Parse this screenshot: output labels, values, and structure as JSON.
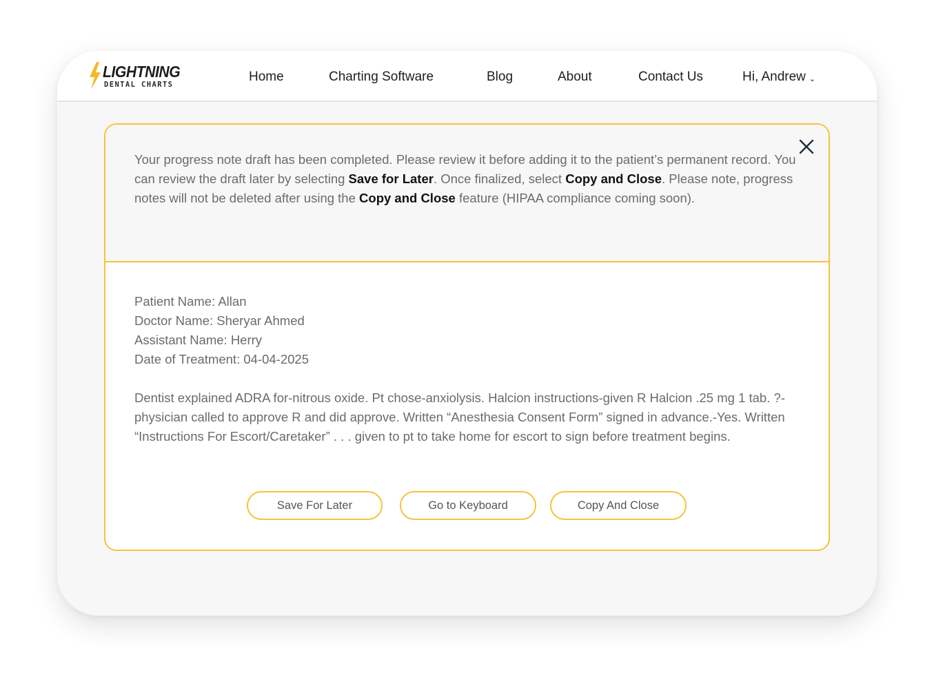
{
  "brand": {
    "name": "LIGHTNING",
    "tagline": "DENTAL CHARTS",
    "accent_color": "#f5c33a"
  },
  "nav": {
    "items": [
      {
        "label": "Home"
      },
      {
        "label": "Charting Software"
      },
      {
        "label": "Blog"
      },
      {
        "label": "About"
      },
      {
        "label": "Contact Us"
      }
    ],
    "user_greeting": "Hi, Andrew",
    "user_menu_icon": "chevron-down-icon"
  },
  "modal": {
    "close_icon": "close-icon",
    "notice": {
      "p1": "Your progress note draft has been completed. Please review it before adding it to the patient’s permanent record. You can review the draft later by selecting ",
      "b1": "Save for Later",
      "p2": ". Once finalized, select ",
      "b2": "Copy and Close",
      "p3": ". Please note, progress notes will not be deleted after using the ",
      "b3": "Copy and Close",
      "p4": " feature (HIPAA compliance coming soon)."
    },
    "note": {
      "patient": "Patient Name: Allan",
      "doctor": "Doctor Name: Sheryar Ahmed",
      "assistant": "Assistant Name: Herry",
      "date": "Date of Treatment: 04-04-2025",
      "text": "Dentist explained ADRA for-nitrous oxide. Pt chose-anxiolysis. Halcion instructions-given R Halcion .25 mg 1 tab. ?-physician called to approve R and did approve. Written “Anesthesia Consent Form” signed in advance.-Yes. Written “Instructions For Escort/Caretaker” . . . given to pt to take home for escort to sign before treatment begins."
    },
    "buttons": {
      "save_later": "Save For Later",
      "keyboard": "Go to Keyboard",
      "copy_close": "Copy And Close"
    }
  }
}
